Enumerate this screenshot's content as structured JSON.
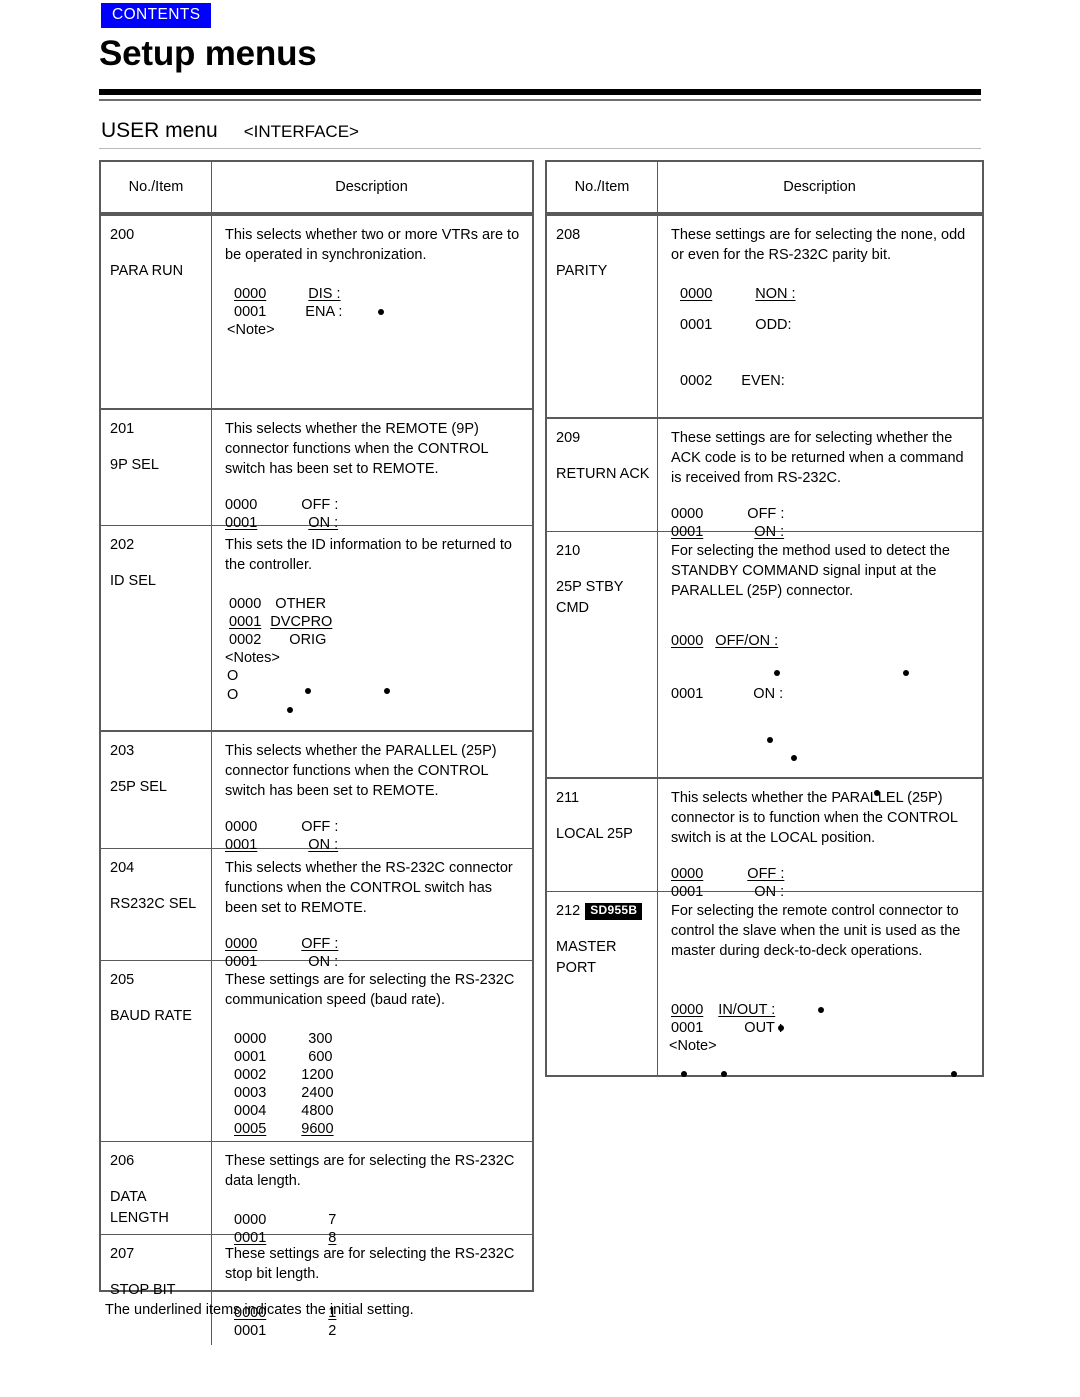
{
  "header": {
    "contents_badge": "CONTENTS",
    "title": "Setup menus",
    "menu_label": "USER menu",
    "menu_group": "<INTERFACE>"
  },
  "table_headers": {
    "no_item": "No./Item",
    "description": "Description"
  },
  "footnote": "The underlined items indicates the initial setting.",
  "left_table": {
    "rows": [
      {
        "no": "200",
        "item": "PARA RUN",
        "desc": "This selects whether two or more VTRs are to\nbe operated in synchronization.",
        "options": [
          {
            "code": "0000",
            "label": "DIS :",
            "code_underline": true,
            "label_underline": true
          },
          {
            "code": "0001",
            "label": "ENA :",
            "code_underline": false,
            "label_underline": false
          }
        ],
        "note": "<Note>"
      },
      {
        "no": "201",
        "item": "9P SEL",
        "desc": "This selects whether the REMOTE (9P)\nconnector functions when the CONTROL\nswitch has been set to REMOTE.",
        "options": [
          {
            "code": "0000",
            "label": "OFF :",
            "code_underline": false,
            "label_underline": false
          },
          {
            "code": "0001",
            "label": "ON :",
            "code_underline": true,
            "label_underline": true
          }
        ]
      },
      {
        "no": "202",
        "item": "ID SEL",
        "desc": "This sets the ID information to be returned to\nthe controller.",
        "options": [
          {
            "code": "0000",
            "label": "OTHER",
            "code_underline": false,
            "label_underline": false
          },
          {
            "code": "0001",
            "label": "DVCPRO",
            "code_underline": true,
            "label_underline": true
          },
          {
            "code": "0002",
            "label": "ORIG",
            "code_underline": false,
            "label_underline": false
          }
        ],
        "note": "<Notes>",
        "bullets_circle": [
          "O",
          "O"
        ]
      },
      {
        "no": "203",
        "item": "25P SEL",
        "desc": "This selects whether the PARALLEL (25P)\nconnector functions when the CONTROL\nswitch has been set to REMOTE.",
        "options": [
          {
            "code": "0000",
            "label": "OFF :",
            "code_underline": false,
            "label_underline": false
          },
          {
            "code": "0001",
            "label": "ON :",
            "code_underline": true,
            "label_underline": true
          }
        ]
      },
      {
        "no": "204",
        "item": "RS232C SEL",
        "desc": "This selects whether the RS-232C connector\nfunctions when the CONTROL switch has\nbeen set to REMOTE.",
        "options": [
          {
            "code": "0000",
            "label": "OFF :",
            "code_underline": true,
            "label_underline": true
          },
          {
            "code": "0001",
            "label": "ON :",
            "code_underline": false,
            "label_underline": false
          }
        ]
      },
      {
        "no": "205",
        "item": "BAUD RATE",
        "desc": "These settings are for selecting the RS-232C\ncommunication speed (baud rate).",
        "options": [
          {
            "code": "0000",
            "label": "300",
            "code_underline": false,
            "label_underline": false
          },
          {
            "code": "0001",
            "label": "600",
            "code_underline": false,
            "label_underline": false
          },
          {
            "code": "0002",
            "label": "1200",
            "code_underline": false,
            "label_underline": false
          },
          {
            "code": "0003",
            "label": "2400",
            "code_underline": false,
            "label_underline": false
          },
          {
            "code": "0004",
            "label": "4800",
            "code_underline": false,
            "label_underline": false
          },
          {
            "code": "0005",
            "label": "9600",
            "code_underline": true,
            "label_underline": true
          }
        ]
      },
      {
        "no": "206",
        "item": "DATA\nLENGTH",
        "desc": "These settings are for selecting the RS-232C\ndata length.",
        "options": [
          {
            "code": "0000",
            "label": "7",
            "code_underline": false,
            "label_underline": false
          },
          {
            "code": "0001",
            "label": "8",
            "code_underline": true,
            "label_underline": true
          }
        ]
      },
      {
        "no": "207",
        "item": "STOP BIT",
        "desc": "These settings are for selecting the RS-232C\nstop bit length.",
        "options": [
          {
            "code": "0000",
            "label": "1",
            "code_underline": true,
            "label_underline": true
          },
          {
            "code": "0001",
            "label": "2",
            "code_underline": false,
            "label_underline": false
          }
        ]
      }
    ]
  },
  "right_table": {
    "rows": [
      {
        "no": "208",
        "item": "PARITY",
        "desc": "These settings are for selecting the none, odd\nor even for the RS-232C parity bit.",
        "options": [
          {
            "code": "0000",
            "label": "NON :",
            "code_underline": true,
            "label_underline": true
          },
          {
            "code": "0001",
            "label": "ODD:",
            "code_underline": false,
            "label_underline": false
          },
          {
            "code": "0002",
            "label": "EVEN:",
            "code_underline": false,
            "label_underline": false
          }
        ]
      },
      {
        "no": "209",
        "item": "RETURN ACK",
        "desc": "These settings are for selecting whether the\nACK code is to be returned when a command\nis received from RS-232C.",
        "options": [
          {
            "code": "0000",
            "label": "OFF :",
            "code_underline": false,
            "label_underline": false
          },
          {
            "code": "0001",
            "label": "ON :",
            "code_underline": true,
            "label_underline": true
          }
        ]
      },
      {
        "no": "210",
        "item": "25P STBY\nCMD",
        "desc": "For selecting the method used to detect the\nSTANDBY COMMAND signal input at the\nPARALLEL (25P) connector.",
        "options": [
          {
            "code": "0000",
            "label": "OFF/ON :",
            "code_underline": true,
            "label_underline": true
          },
          {
            "code": "0001",
            "label": "ON :",
            "code_underline": false,
            "label_underline": false
          }
        ]
      },
      {
        "no": "211",
        "item": "LOCAL 25P",
        "desc": "This selects whether the PARALLEL (25P)\nconnector is to function when the CONTROL\nswitch is at the LOCAL position.",
        "options": [
          {
            "code": "0000",
            "label": "OFF :",
            "code_underline": true,
            "label_underline": true
          },
          {
            "code": "0001",
            "label": "ON :",
            "code_underline": false,
            "label_underline": false
          }
        ]
      },
      {
        "no": "212",
        "badge": "SD955B",
        "item": "MASTER\nPORT",
        "desc": "For selecting the remote control connector to\ncontrol the slave when the unit is used as the\nmaster during deck-to-deck operations.",
        "options": [
          {
            "code": "0000",
            "label": "IN/OUT :",
            "code_underline": true,
            "label_underline": true
          },
          {
            "code": "0001",
            "label": "OUT :",
            "code_underline": false,
            "label_underline": false
          }
        ],
        "note": "<Note>"
      }
    ]
  }
}
